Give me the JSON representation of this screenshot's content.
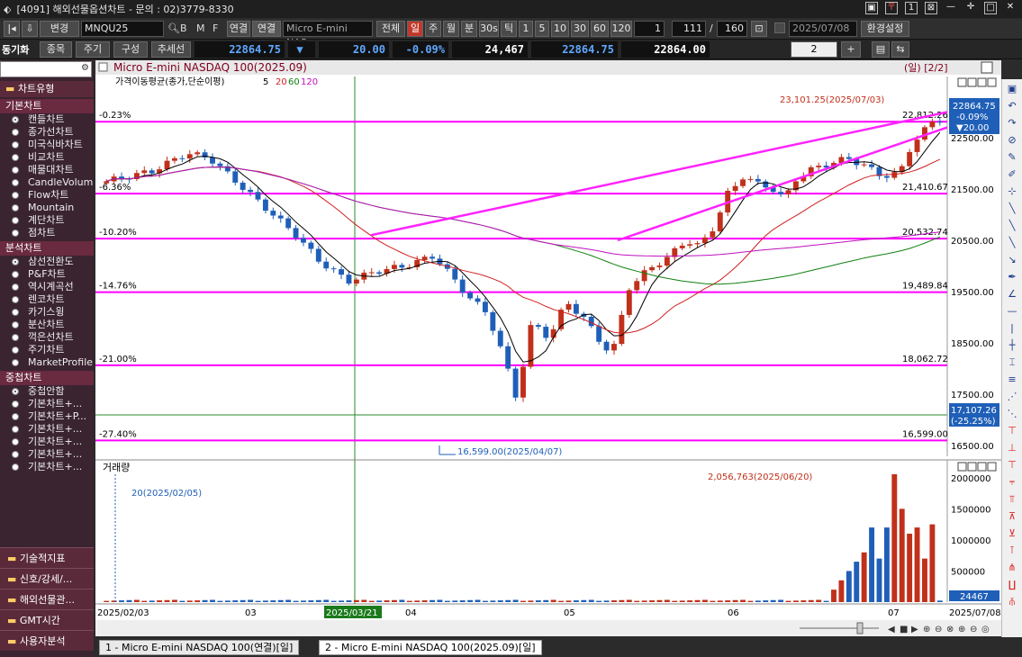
{
  "window": {
    "title": "[4091] 해외선물옵션차트 - 문의 : 02)3779-8330"
  },
  "toolbar": {
    "change_label": "변경",
    "symbol": "MNQU25",
    "b_label": "B",
    "m_label": "M",
    "f_label": "F",
    "link_label": "연결",
    "symbol_name": "Micro E-mini NAS",
    "all_label": "전체",
    "periods": [
      "일",
      "주",
      "월",
      "분",
      "30s",
      "틱"
    ],
    "minutes": [
      "1",
      "5",
      "10",
      "30",
      "60",
      "120"
    ],
    "interval_value": "1",
    "count_value": "111",
    "total_value": "160",
    "date_value": "2025/07/08",
    "settings_label": "환경설정"
  },
  "toolbar2": {
    "sync_label": "동기화",
    "item_label": "종목",
    "period_label": "주기",
    "layout_label": "구성",
    "trendline_label": "추세선",
    "price": "22864.75",
    "arrow": "▼",
    "change": "20.00",
    "change_pct": "-0.09%",
    "volume": "24,467",
    "price2": "22864.75",
    "price3": "22864.00",
    "panel_count": "2"
  },
  "sidebar": {
    "sections": [
      {
        "title": "기본차트",
        "items": [
          "캔들차트",
          "종가선차트",
          "미국식바차트",
          "비교차트",
          "매물대차트",
          "CandleVolume",
          "Flow차트",
          "Mountain",
          "계단차트",
          "점차트"
        ]
      },
      {
        "title": "분석차트",
        "items": [
          "삼선전환도",
          "P&F차트",
          "역시계곡선",
          "렌코차트",
          "카기스윙",
          "분산차트",
          "꺽은선차트",
          "주기차트",
          "MarketProfile"
        ]
      },
      {
        "title": "중첩차트",
        "items": [
          "중첩안함",
          "기본차트+...",
          "기본차트+P...",
          "기본차트+...",
          "기본차트+...",
          "기본차트+...",
          "기본차트+..."
        ]
      }
    ],
    "header": "차트유형",
    "bottom": [
      "기술적지표",
      "신호/강세/...",
      "해외선물관...",
      "GMT시간",
      "사용자분석"
    ]
  },
  "chart": {
    "title": "Micro E-mini NASDAQ 100(2025.09)",
    "period_indicator": "(일) [2/2]",
    "ma_label": "가격이동평균(종가,단순이평)",
    "ma_periods": [
      "5",
      "20",
      "60",
      "120"
    ],
    "ma_colors": [
      "#000000",
      "#d02020",
      "#108010",
      "#c010c0"
    ],
    "hlines": [
      {
        "pct": "-0.23%",
        "price": "22,812.26"
      },
      {
        "pct": "-6.36%",
        "price": "21,410.67"
      },
      {
        "pct": "-10.20%",
        "price": "20,532.74"
      },
      {
        "pct": "-14.76%",
        "price": "19,489.84"
      },
      {
        "pct": "-21.00%",
        "price": "18,062.72"
      },
      {
        "pct": "-27.40%",
        "price": "16,599.00"
      }
    ],
    "y_ticks": [
      "22500.00",
      "21500.00",
      "20500.00",
      "19500.00",
      "18500.00",
      "17500.00",
      "16500.00"
    ],
    "current_price": "22864.75",
    "current_change_pct": "-0.09%",
    "current_change": "▼20.00",
    "cursor_price": "17,107.26",
    "cursor_pct": "(-25.25%)",
    "high_annotation": "23,101.25(2025/07/03)",
    "low_annotation": "16,599.00(2025/04/07)",
    "volume_title": "거래량",
    "volume_y_ticks": [
      "2000000",
      "1500000",
      "1000000",
      "500000"
    ],
    "volume_high_annotation": "2,056,763(2025/06/20)",
    "volume_start_annotation": "20(2025/02/05)",
    "volume_current": "24467",
    "x_labels": [
      "2025/02/03",
      "03",
      "2025/03/21",
      "04",
      "05",
      "06",
      "07",
      "2025/07/08"
    ],
    "colors": {
      "up": "#c0301a",
      "down": "#1f5fb8",
      "hline": "#ff00ff",
      "trend": "#ff22ff"
    }
  },
  "bottom_tabs": [
    "1 - Micro E-mini NASDAQ 100(연결)[일]",
    "2 - Micro E-mini NASDAQ 100(2025.09)[일]"
  ]
}
